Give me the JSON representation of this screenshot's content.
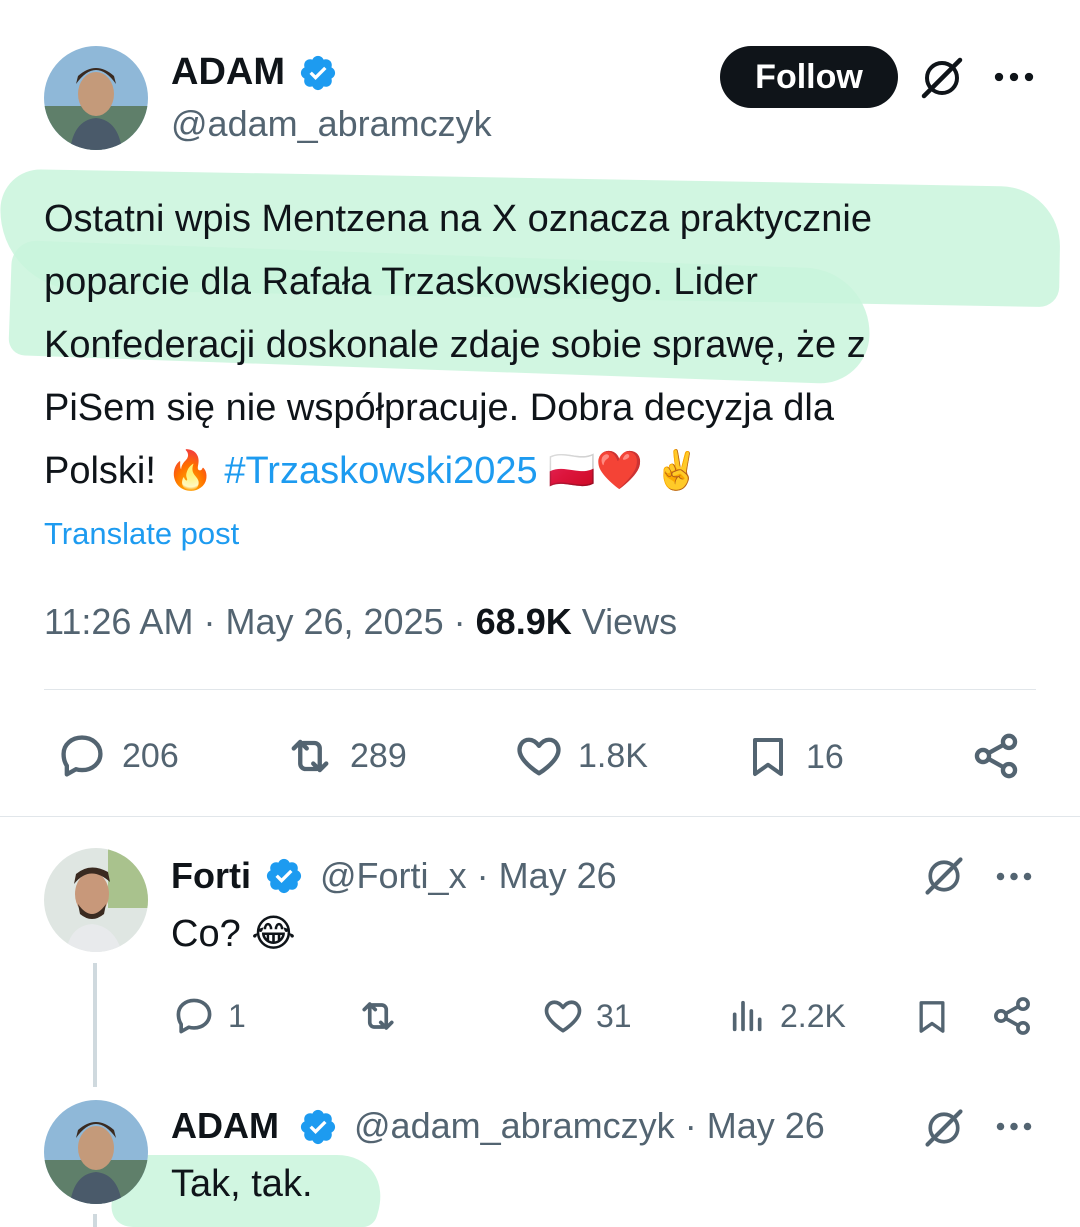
{
  "main_post": {
    "author_name": "ADAM",
    "author_handle": "@adam_abramczyk",
    "follow_label": "Follow",
    "text_lines": [
      "Ostatni wpis Mentzena na X oznacza praktycznie",
      "poparcie dla Rafała Trzaskowskiego. Lider",
      "Konfederacji doskonale zdaje sobie sprawę, że z",
      "PiSem  się nie współpracuje. Dobra decyzja dla"
    ],
    "text_last_prefix": "Polski! ",
    "emoji_fire": "🔥",
    "hashtag": "#Trzaskowski2025",
    "emoji_tail": "🇵🇱❤️ ✌️",
    "translate_label": "Translate post",
    "time": "11:26 AM",
    "date": "May 26, 2025",
    "views_count": "68.9K",
    "views_label": "Views",
    "separator": "·",
    "replies": "206",
    "reposts": "289",
    "likes": "1.8K",
    "bookmarks": "16"
  },
  "reply_1": {
    "author_name": "Forti",
    "author_handle": "@Forti_x",
    "date": "May 26",
    "separator": "·",
    "text": "Co? 😂",
    "replies": "1",
    "likes": "31",
    "views": "2.2K"
  },
  "reply_2": {
    "author_name": "ADAM",
    "author_handle": "@adam_abramczyk",
    "date": "May 26",
    "separator": "·",
    "text": "Tak, tak."
  },
  "colors": {
    "accent": "#1d9bf0",
    "verified": "#1d9bf0",
    "text": "#0f1419",
    "muted": "#536471",
    "highlight": "#c9f5dc"
  },
  "icons": [
    "verified-badge-icon",
    "grok-icon",
    "more-icon",
    "reply-icon",
    "repost-icon",
    "like-icon",
    "bookmark-icon",
    "share-icon",
    "views-icon"
  ]
}
